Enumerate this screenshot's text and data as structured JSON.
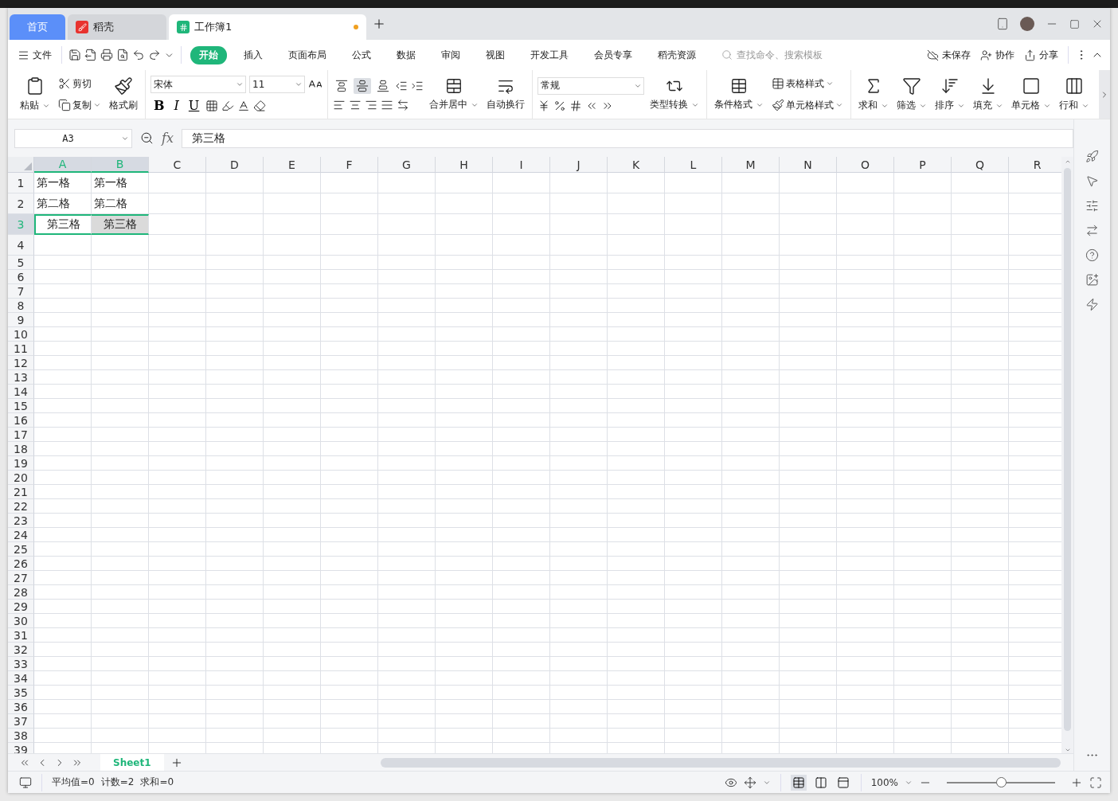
{
  "tabs": [
    {
      "label": "首页",
      "kind": "home",
      "selected": false
    },
    {
      "label": "稻壳",
      "kind": "docer",
      "selected": false
    },
    {
      "label": "工作簿1",
      "kind": "sheet",
      "selected": true
    }
  ],
  "menu": {
    "file": "文件",
    "ribbon_tabs": [
      {
        "label": "开始",
        "selected": true
      },
      {
        "label": "插入",
        "selected": false
      },
      {
        "label": "页面布局",
        "selected": false
      },
      {
        "label": "公式",
        "selected": false
      },
      {
        "label": "数据",
        "selected": false
      },
      {
        "label": "审阅",
        "selected": false
      },
      {
        "label": "视图",
        "selected": false
      },
      {
        "label": "开发工具",
        "selected": false
      },
      {
        "label": "会员专享",
        "selected": false
      },
      {
        "label": "稻壳资源",
        "selected": false
      }
    ],
    "search": {
      "placeholder": "查找命令、搜索模板"
    },
    "actions": [
      {
        "label": "未保存",
        "kind": "cloud"
      },
      {
        "label": "协作",
        "kind": "collab"
      },
      {
        "label": "分享",
        "kind": "share"
      }
    ]
  },
  "ribbon": {
    "clipboard": {
      "paste": "粘贴",
      "cut": "剪切",
      "copy": "复制",
      "format_painter": "格式刷"
    },
    "font": {
      "name": "宋体",
      "size": "11",
      "styles": [
        {
          "label": "B",
          "kind": "bold"
        },
        {
          "label": "I",
          "kind": "italic"
        },
        {
          "label": "U",
          "kind": "underline"
        }
      ]
    },
    "vertical_align": [
      {
        "kind": "top",
        "selected": false
      },
      {
        "kind": "middle",
        "selected": true
      },
      {
        "kind": "bottom",
        "selected": false
      }
    ],
    "merge": "合并居中",
    "wrap": "自动换行",
    "number": {
      "format": "常规",
      "convert": "类型转换"
    },
    "styles": {
      "conditional": "条件格式",
      "table_style": "表格样式",
      "cell_style": "单元格样式"
    },
    "tools": [
      {
        "label": "求和",
        "kind": "sum"
      },
      {
        "label": "筛选",
        "kind": "filter"
      },
      {
        "label": "排序",
        "kind": "sort"
      },
      {
        "label": "填充",
        "kind": "fill"
      },
      {
        "label": "单元格",
        "kind": "cell"
      },
      {
        "label": "行和",
        "kind": "rowcol"
      }
    ]
  },
  "formula_bar": {
    "cell_ref": "A3",
    "fx": "fx",
    "value": "第三格"
  },
  "sheet": {
    "columns": [
      {
        "label": "A",
        "selected": true
      },
      {
        "label": "B",
        "selected": true
      },
      {
        "label": "C",
        "selected": false
      },
      {
        "label": "D",
        "selected": false
      },
      {
        "label": "E",
        "selected": false
      },
      {
        "label": "F",
        "selected": false
      },
      {
        "label": "G",
        "selected": false
      },
      {
        "label": "H",
        "selected": false
      },
      {
        "label": "I",
        "selected": false
      },
      {
        "label": "J",
        "selected": false
      },
      {
        "label": "K",
        "selected": false
      },
      {
        "label": "L",
        "selected": false
      },
      {
        "label": "M",
        "selected": false
      },
      {
        "label": "N",
        "selected": false
      },
      {
        "label": "O",
        "selected": false
      },
      {
        "label": "P",
        "selected": false
      },
      {
        "label": "Q",
        "selected": false
      },
      {
        "label": "R",
        "selected": false
      }
    ],
    "rows": [
      {
        "label": "1",
        "selected": false,
        "cells": [
          {
            "text": "第一格",
            "selected": false,
            "active": false,
            "centered": false
          },
          {
            "text": "第一格",
            "selected": false,
            "active": false,
            "centered": false
          }
        ]
      },
      {
        "label": "2",
        "selected": false,
        "cells": [
          {
            "text": "第二格",
            "selected": false,
            "active": false,
            "centered": false
          },
          {
            "text": "第二格",
            "selected": false,
            "active": false,
            "centered": false
          }
        ]
      },
      {
        "label": "3",
        "selected": true,
        "cells": [
          {
            "text": "第三格",
            "selected": true,
            "active": true,
            "centered": true
          },
          {
            "text": "第三格",
            "selected": true,
            "active": false,
            "centered": true
          }
        ]
      },
      {
        "label": "4",
        "selected": false
      },
      {
        "label": "5",
        "selected": false
      },
      {
        "label": "6",
        "selected": false
      },
      {
        "label": "7",
        "selected": false
      },
      {
        "label": "8",
        "selected": false
      },
      {
        "label": "9",
        "selected": false
      },
      {
        "label": "10",
        "selected": false
      },
      {
        "label": "11",
        "selected": false
      },
      {
        "label": "12",
        "selected": false
      },
      {
        "label": "13",
        "selected": false
      },
      {
        "label": "14",
        "selected": false
      },
      {
        "label": "15",
        "selected": false
      },
      {
        "label": "16",
        "selected": false
      },
      {
        "label": "17",
        "selected": false
      },
      {
        "label": "18",
        "selected": false
      },
      {
        "label": "19",
        "selected": false
      },
      {
        "label": "20",
        "selected": false
      },
      {
        "label": "21",
        "selected": false
      },
      {
        "label": "22",
        "selected": false
      },
      {
        "label": "23",
        "selected": false
      },
      {
        "label": "24",
        "selected": false
      },
      {
        "label": "25",
        "selected": false
      },
      {
        "label": "26",
        "selected": false
      },
      {
        "label": "27",
        "selected": false
      },
      {
        "label": "28",
        "selected": false
      },
      {
        "label": "29",
        "selected": false
      },
      {
        "label": "30",
        "selected": false
      },
      {
        "label": "31",
        "selected": false
      },
      {
        "label": "32",
        "selected": false
      },
      {
        "label": "33",
        "selected": false
      },
      {
        "label": "34",
        "selected": false
      },
      {
        "label": "35",
        "selected": false
      },
      {
        "label": "36",
        "selected": false
      },
      {
        "label": "37",
        "selected": false
      },
      {
        "label": "38",
        "selected": false
      },
      {
        "label": "39",
        "selected": false
      }
    ]
  },
  "sheet_tabs": [
    {
      "label": "Sheet1",
      "selected": true
    }
  ],
  "status_bar": {
    "stats": [
      "平均值=0",
      "计数=2",
      "求和=0"
    ],
    "zoom": "100%",
    "zoom_slider": {
      "level": 0.5
    }
  }
}
